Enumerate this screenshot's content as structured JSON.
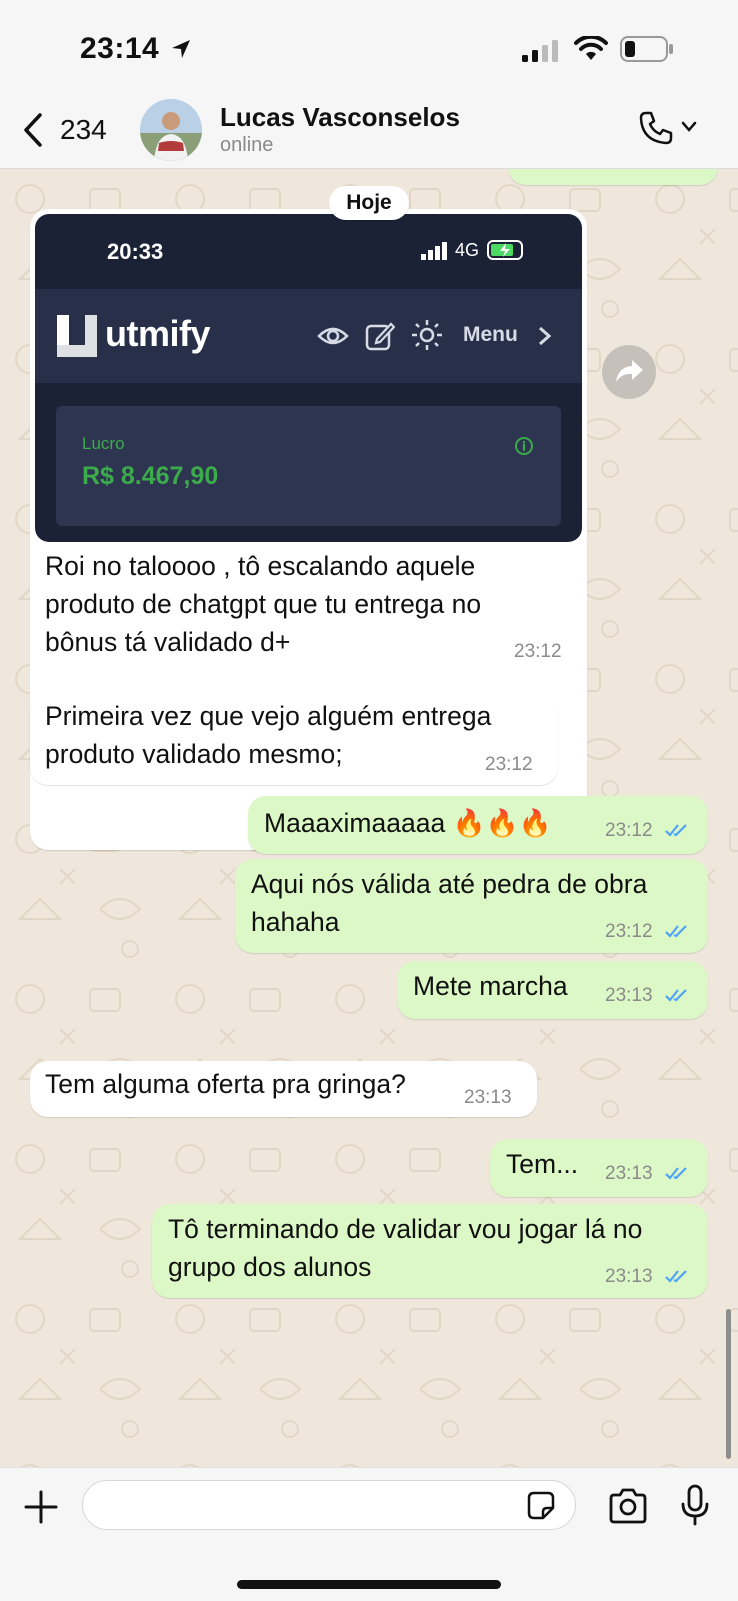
{
  "status_bar": {
    "time": "23:14"
  },
  "header": {
    "back_count": "234",
    "contact_name": "Lucas Vasconselos",
    "contact_status": "online"
  },
  "chat": {
    "date_label": "Hoje",
    "image_message": {
      "screenshot": {
        "time": "20:33",
        "network": "4G",
        "brand": "utmify",
        "menu_label": "Menu",
        "card_label": "Lucro",
        "card_value": "R$ 8.467,90"
      },
      "caption": "Roi no taloooo , tô escalando aquele\nproduto de chatgpt que tu entrega no\nbônus tá validado d+",
      "time": "23:12"
    },
    "messages": [
      {
        "direction": "in",
        "text": "Primeira vez que vejo alguém entrega\nproduto validado mesmo;",
        "time": "23:12"
      },
      {
        "direction": "out",
        "text": "Maaaximaaaaa 🔥🔥🔥",
        "time": "23:12"
      },
      {
        "direction": "out",
        "text": "Aqui nós válida até pedra de obra\nhahaha",
        "time": "23:12"
      },
      {
        "direction": "out",
        "text": "Mete marcha",
        "time": "23:13"
      },
      {
        "direction": "in",
        "text": "Tem alguma oferta pra gringa?",
        "time": "23:13"
      },
      {
        "direction": "out",
        "text": "Tem...",
        "time": "23:13"
      },
      {
        "direction": "out",
        "text": "Tô terminando de validar vou jogar lá no\ngrupo dos alunos",
        "time": "23:13"
      }
    ]
  },
  "input": {
    "placeholder": "",
    "value": ""
  },
  "colors": {
    "outgoing_bubble": "#dcf8c6",
    "incoming_bubble": "#ffffff",
    "chat_background": "#efe7dc",
    "read_ticks": "#4fa3f7",
    "profit_green": "#3cab4b"
  },
  "icons": [
    "location-arrow-icon",
    "signal-icon",
    "wifi-icon",
    "battery-icon",
    "back-chevron-icon",
    "phone-icon",
    "chevron-down-icon",
    "forward-icon",
    "plus-icon",
    "sticker-icon",
    "camera-icon",
    "microphone-icon",
    "double-check-icon"
  ]
}
